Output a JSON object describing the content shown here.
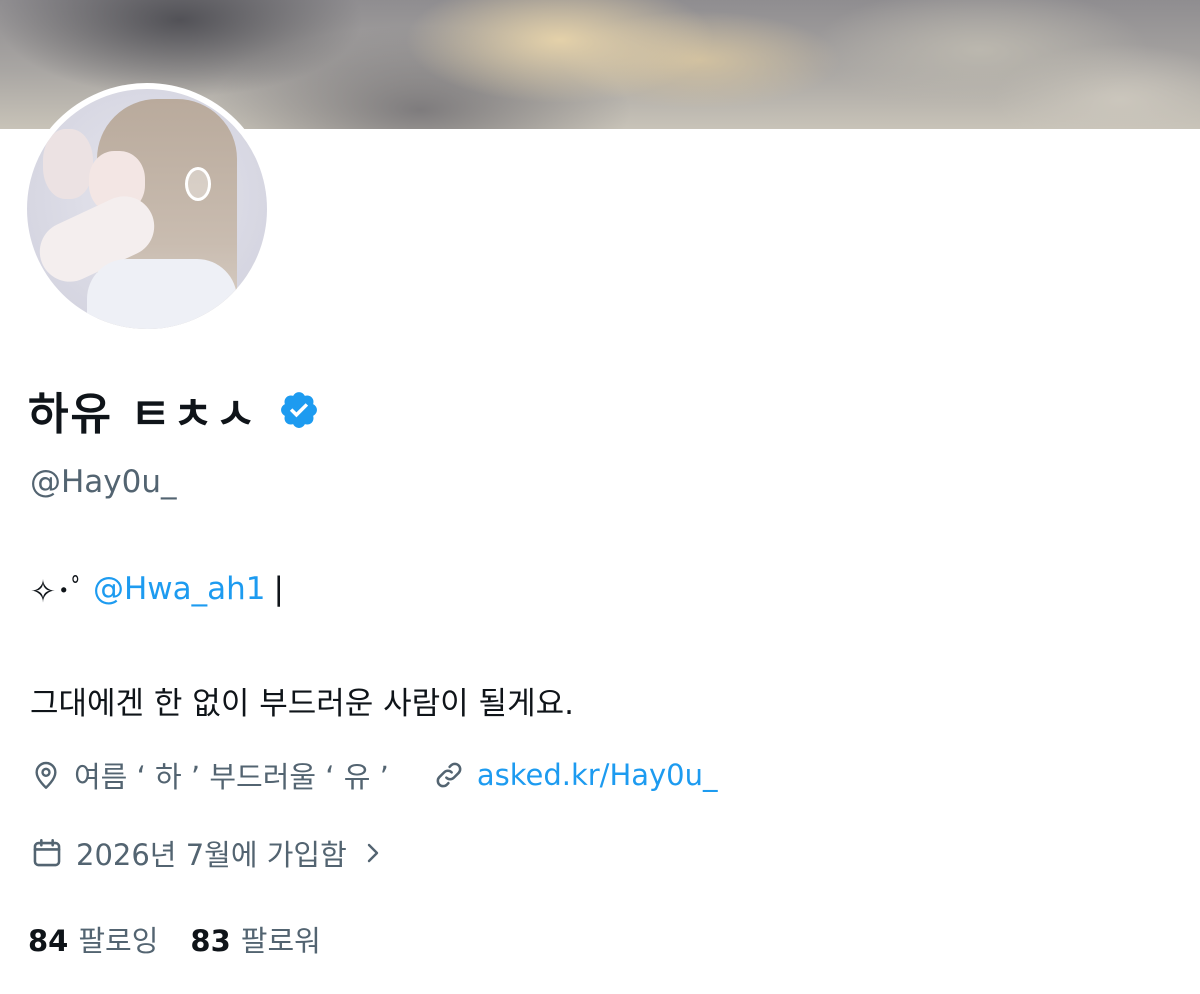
{
  "profile": {
    "display_name": "하유 ㅌㅊㅅ",
    "handle": "@Hay0u_",
    "verified": true,
    "bio": {
      "prefix_symbols": "✧･ﾟ",
      "mention": "@Hwa_ah1",
      "separator": "|",
      "tagline": "그대에겐 한 없이 부드러운 사람이 될게요."
    },
    "location": "여름 ‘ 하 ’ 부드러울 ‘ 유 ’",
    "website": "asked.kr/Hay0u_",
    "joined": "2026년 7월에 가입함",
    "following_count": "84",
    "following_label": "팔로잉",
    "followers_count": "83",
    "followers_label": "팔로워"
  },
  "icons": {
    "verified": "verified-badge-icon",
    "location": "location-pin-icon",
    "link": "link-icon",
    "calendar": "calendar-icon",
    "chevron": "chevron-right-icon"
  },
  "colors": {
    "accent": "#1d9bf0",
    "secondary_text": "#536471",
    "primary_text": "#0f1419",
    "background": "#ffffff"
  }
}
